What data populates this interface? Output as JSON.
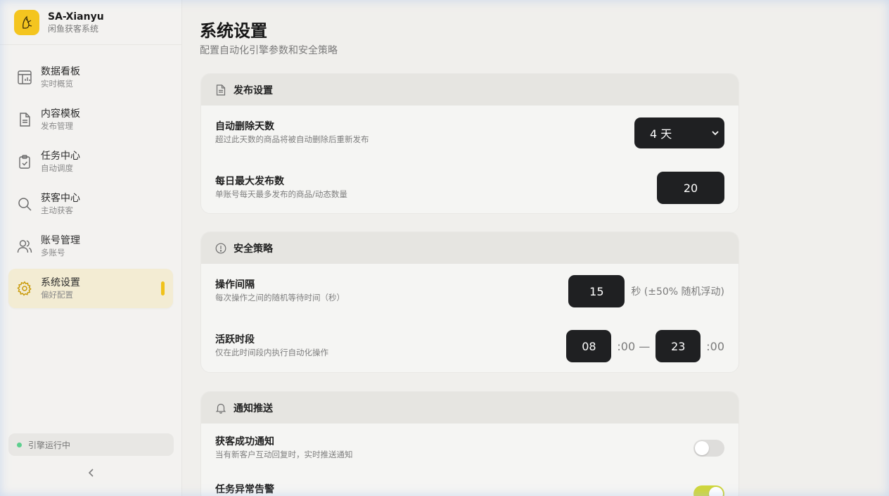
{
  "brand": {
    "name": "SA-Xianyu",
    "subtitle": "闲鱼获客系统"
  },
  "sidebar": {
    "items": [
      {
        "label": "数据看板",
        "sub": "实时概览",
        "icon": "dashboard-icon"
      },
      {
        "label": "内容模板",
        "sub": "发布管理",
        "icon": "document-icon"
      },
      {
        "label": "任务中心",
        "sub": "自动调度",
        "icon": "clipboard-check-icon"
      },
      {
        "label": "获客中心",
        "sub": "主动获客",
        "icon": "search-icon"
      },
      {
        "label": "账号管理",
        "sub": "多账号",
        "icon": "users-icon"
      },
      {
        "label": "系统设置",
        "sub": "偏好配置",
        "icon": "gear-icon",
        "active": true
      }
    ],
    "engine_status": "引擎运行中"
  },
  "page": {
    "title": "系统设置",
    "subtitle": "配置自动化引擎参数和安全策略"
  },
  "publish": {
    "title": "发布设置",
    "auto_delete": {
      "label": "自动删除天数",
      "desc": "超过此天数的商品将被自动删除后重新发布",
      "value": "4 天"
    },
    "daily_max": {
      "label": "每日最大发布数",
      "desc": "单账号每天最多发布的商品/动态数量",
      "value": "20"
    }
  },
  "security": {
    "title": "安全策略",
    "interval": {
      "label": "操作间隔",
      "desc": "每次操作之间的随机等待时间（秒）",
      "value": "15",
      "suffix": "秒 (±50% 随机浮动)"
    },
    "active_hours": {
      "label": "活跃时段",
      "desc": "仅在此时间段内执行自动化操作",
      "start": "08",
      "end": "23",
      "start_suffix": ":00 —",
      "end_suffix": ":00"
    }
  },
  "notify": {
    "title": "通知推送",
    "lead_success": {
      "label": "获客成功通知",
      "desc": "当有新客户互动回复时，实时推送通知",
      "enabled": false
    },
    "task_alert": {
      "label": "任务异常告警",
      "enabled": true
    }
  },
  "colors": {
    "accent": "#f0c21b",
    "toggle_on": "#cfd63a",
    "status_green": "#5dcf8e",
    "dark_control": "#1f2022"
  }
}
